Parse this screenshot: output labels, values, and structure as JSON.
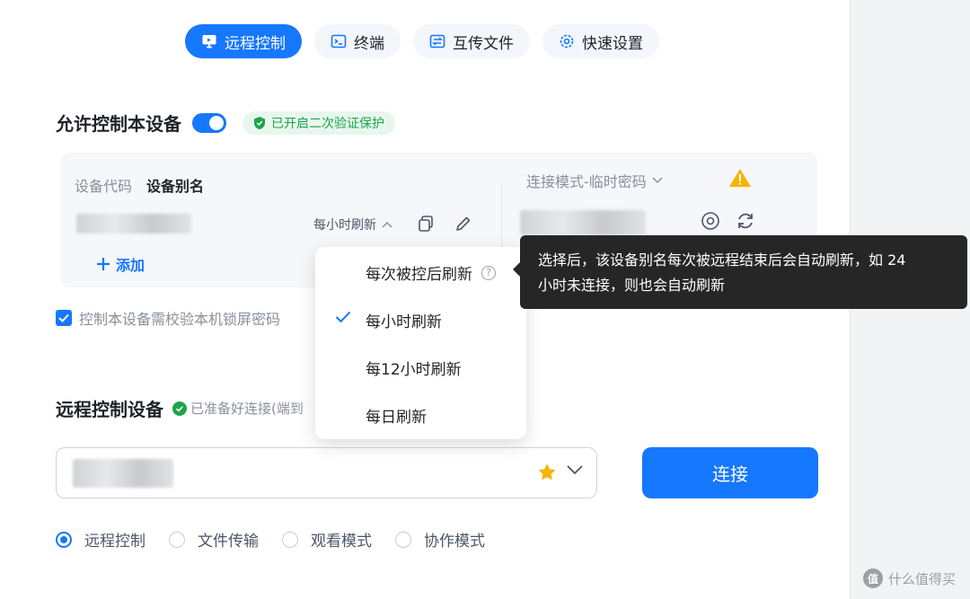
{
  "tabs": [
    {
      "label": "远程控制",
      "icon": "monitor-icon",
      "active": true
    },
    {
      "label": "终端",
      "icon": "terminal-icon",
      "active": false
    },
    {
      "label": "互传文件",
      "icon": "file-transfer-icon",
      "active": false
    },
    {
      "label": "快速设置",
      "icon": "gear-icon",
      "active": false
    }
  ],
  "allow_control": {
    "title": "允许控制本设备",
    "toggle_on": true,
    "badge": "已开启二次验证保护"
  },
  "device_card": {
    "tab_code": "设备代码",
    "tab_alias": "设备别名",
    "refresh_label": "每小时刷新",
    "add_label": "添加",
    "conn_mode": "连接模式-临时密码"
  },
  "lockscreen_check": {
    "label": "控制本设备需校验本机锁屏密码",
    "checked": true
  },
  "remote_control": {
    "title": "远程控制设备",
    "status": "已准备好连接(端到"
  },
  "connect_button": "连接",
  "modes": [
    {
      "label": "远程控制",
      "selected": true
    },
    {
      "label": "文件传输",
      "selected": false
    },
    {
      "label": "观看模式",
      "selected": false
    },
    {
      "label": "协作模式",
      "selected": false
    }
  ],
  "refresh_dropdown": {
    "options": [
      {
        "label": "每次被控后刷新",
        "selected": false,
        "help": true
      },
      {
        "label": "每小时刷新",
        "selected": true,
        "help": false
      },
      {
        "label": "每12小时刷新",
        "selected": false,
        "help": false
      },
      {
        "label": "每日刷新",
        "selected": false,
        "help": false
      }
    ]
  },
  "tooltip": {
    "line1": "选择后，该设备别名每次被远程结束后会自动刷新，如 24",
    "line2": "小时未连接，则也会自动刷新"
  },
  "watermark": "什么值得买",
  "colors": {
    "accent": "#1677ff",
    "success": "#1ea34a",
    "warning": "#f5b400",
    "tooltip_bg": "#262626"
  }
}
